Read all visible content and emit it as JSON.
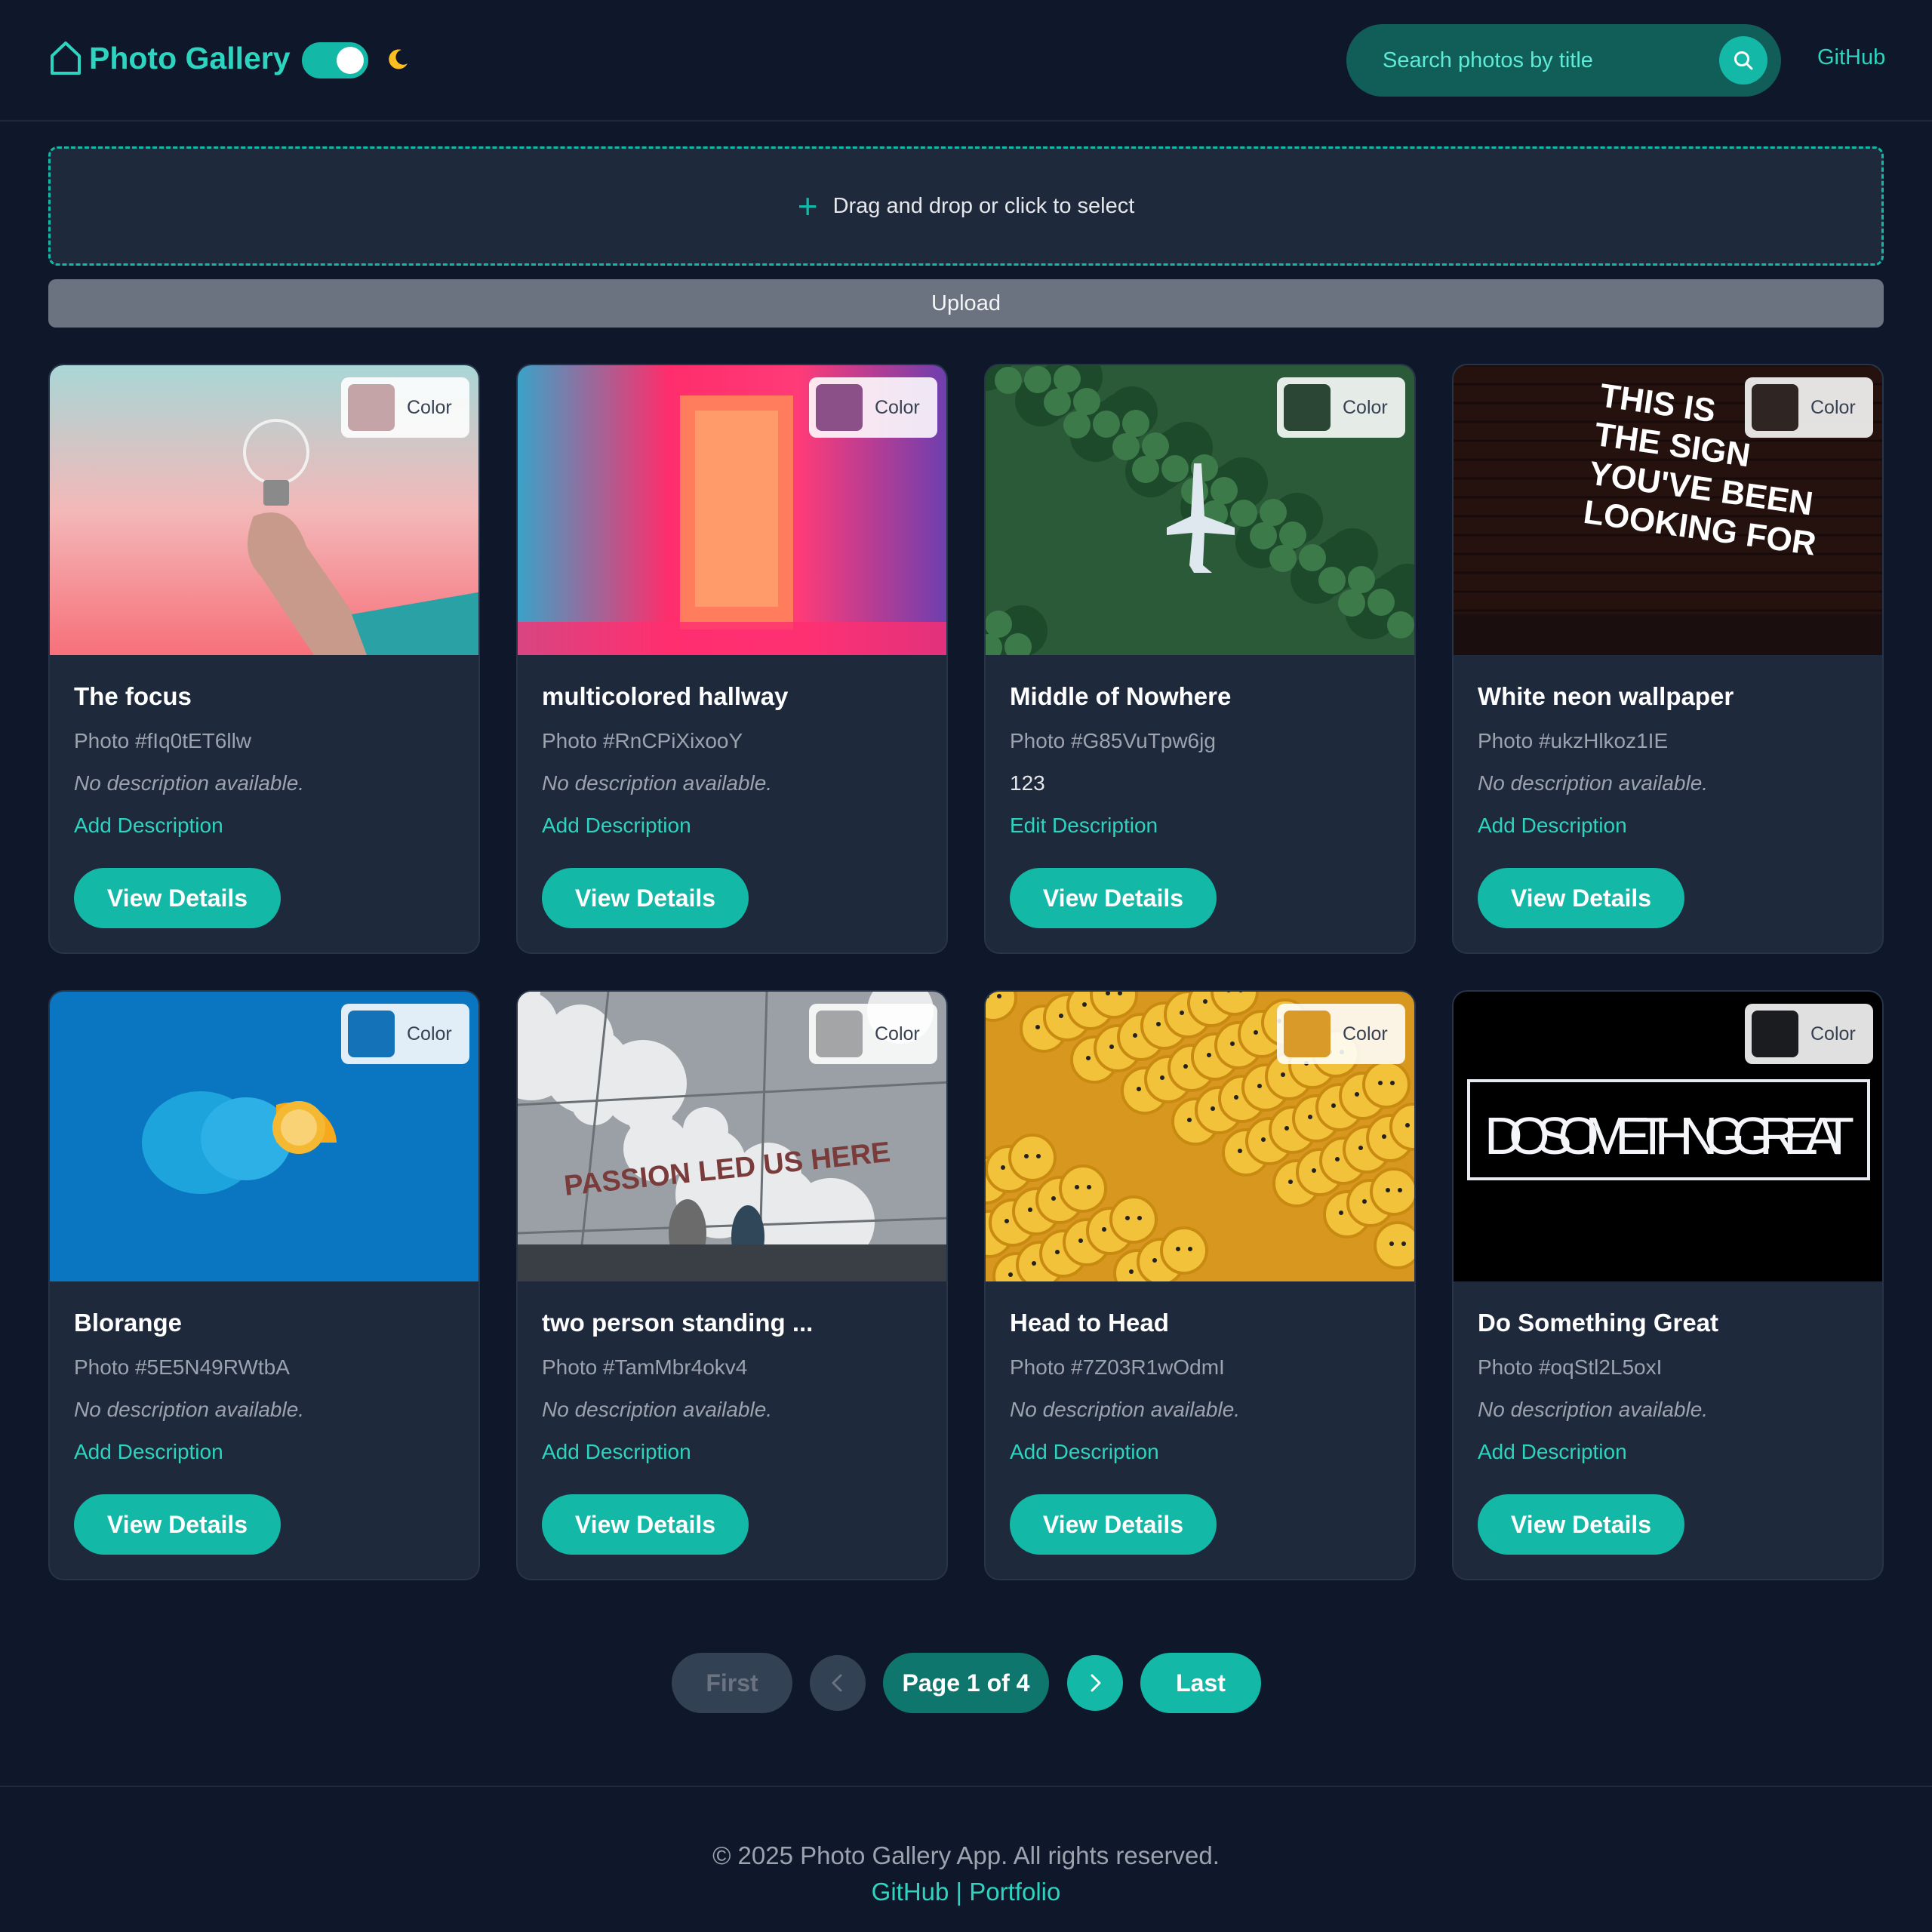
{
  "header": {
    "brand_title": "Photo Gallery",
    "theme_toggle": "on",
    "search_placeholder": "Search photos by title",
    "github_label": "GitHub"
  },
  "upload": {
    "dropzone_plus": "+",
    "dropzone_text": "Drag and drop or click to select",
    "button_label": "Upload"
  },
  "photos": [
    {
      "title": "The focus",
      "id_text": "Photo #fIq0tET6llw",
      "description": "No description available.",
      "has_description": false,
      "action": "Add Description",
      "color_label": "Color",
      "swatch": "#c4a4a7",
      "button": "View Details"
    },
    {
      "title": "multicolored hallway",
      "id_text": "Photo #RnCPiXixooY",
      "description": "No description available.",
      "has_description": false,
      "action": "Add Description",
      "color_label": "Color",
      "swatch": "#8c5088",
      "button": "View Details"
    },
    {
      "title": "Middle of Nowhere",
      "id_text": "Photo #G85VuTpw6jg",
      "description": "123",
      "has_description": true,
      "action": "Edit Description",
      "color_label": "Color",
      "swatch": "#2b4634",
      "button": "View Details"
    },
    {
      "title": "White neon wallpaper",
      "id_text": "Photo #ukzHlkoz1IE",
      "description": "No description available.",
      "has_description": false,
      "action": "Add Description",
      "color_label": "Color",
      "swatch": "#2f2523",
      "button": "View Details"
    },
    {
      "title": "Blorange",
      "id_text": "Photo #5E5N49RWtbA",
      "description": "No description available.",
      "has_description": false,
      "action": "Add Description",
      "color_label": "Color",
      "swatch": "#1473b8",
      "button": "View Details"
    },
    {
      "title": "two person standing ...",
      "id_text": "Photo #TamMbr4okv4",
      "description": "No description available.",
      "has_description": false,
      "action": "Add Description",
      "color_label": "Color",
      "swatch": "#a4a5a6",
      "button": "View Details"
    },
    {
      "title": "Head to Head",
      "id_text": "Photo #7Z03R1wOdmI",
      "description": "No description available.",
      "has_description": false,
      "action": "Add Description",
      "color_label": "Color",
      "swatch": "#da9a29",
      "button": "View Details"
    },
    {
      "title": "Do Something Great",
      "id_text": "Photo #oqStl2L5oxI",
      "description": "No description available.",
      "has_description": false,
      "action": "Add Description",
      "color_label": "Color",
      "swatch": "#1a1c1f",
      "button": "View Details"
    }
  ],
  "image_text": {
    "neon_lines": [
      "THIS IS",
      "THE SIGN",
      "YOU'VE BEEN",
      "LOOKING FOR"
    ],
    "neon_sign": "DO SOMETHING GREAT",
    "floor_text": "PASSION LED US HERE"
  },
  "pagination": {
    "first": "First",
    "page_label": "Page 1 of 4",
    "last": "Last"
  },
  "footer": {
    "copyright": "© 2025 Photo Gallery App. All rights reserved.",
    "links": "GitHub | Portfolio"
  },
  "colors": {
    "accent": "#14b8a6",
    "accent_text": "#2dd4bf",
    "background": "#0f172a",
    "card": "#1e293b"
  }
}
